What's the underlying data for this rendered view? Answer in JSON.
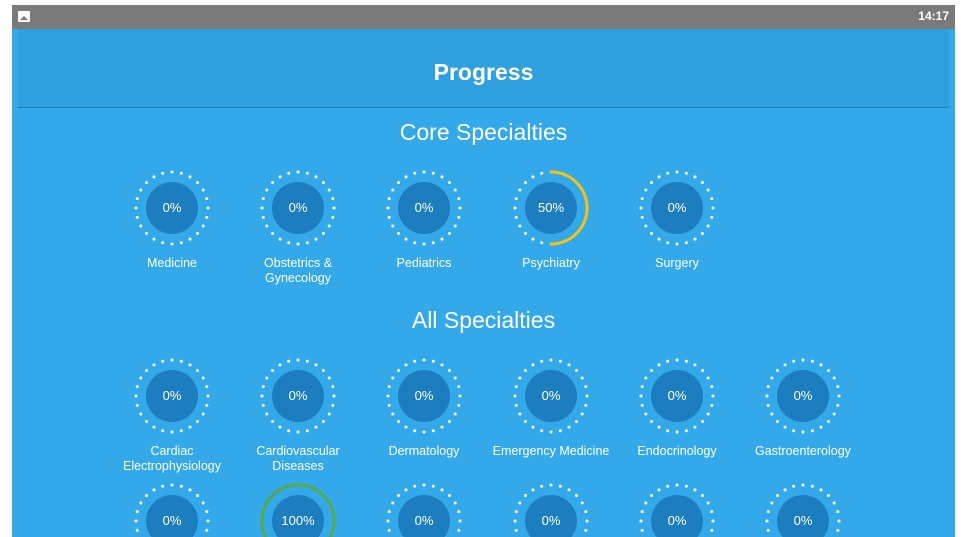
{
  "status_bar": {
    "time": "14:17"
  },
  "toolbar": {
    "title": "Progress"
  },
  "sections": [
    {
      "title": "Core Specialties",
      "items": [
        {
          "label": "Medicine",
          "percent_text": "0%",
          "progress": 0
        },
        {
          "label": "Obstetrics & Gynecology",
          "percent_text": "0%",
          "progress": 0
        },
        {
          "label": "Pediatrics",
          "percent_text": "0%",
          "progress": 0
        },
        {
          "label": "Psychiatry",
          "percent_text": "50%",
          "progress": 0.5
        },
        {
          "label": "Surgery",
          "percent_text": "0%",
          "progress": 0
        }
      ]
    },
    {
      "title": "All Specialties",
      "items": [
        {
          "label": "Cardiac Electrophysiology",
          "percent_text": "0%",
          "progress": 0
        },
        {
          "label": "Cardiovascular Diseases",
          "percent_text": "0%",
          "progress": 0
        },
        {
          "label": "Dermatology",
          "percent_text": "0%",
          "progress": 0
        },
        {
          "label": "Emergency Medicine",
          "percent_text": "0%",
          "progress": 0
        },
        {
          "label": "Endocrinology",
          "percent_text": "0%",
          "progress": 0
        },
        {
          "label": "Gastroenterology",
          "percent_text": "0%",
          "progress": 0
        },
        {
          "label": "",
          "percent_text": "0%",
          "progress": 0
        },
        {
          "label": "",
          "percent_text": "100%",
          "progress": 1
        },
        {
          "label": "",
          "percent_text": "0%",
          "progress": 0
        },
        {
          "label": "",
          "percent_text": "0%",
          "progress": 0
        },
        {
          "label": "",
          "percent_text": "0%",
          "progress": 0
        },
        {
          "label": "",
          "percent_text": "0%",
          "progress": 0
        }
      ]
    }
  ],
  "colors": {
    "background": "#33a9e9",
    "toolbar": "#2ea0de",
    "circle": "#1c7ebf",
    "partial_arc": "#f2c21b",
    "complete_arc": "#55a84b"
  }
}
